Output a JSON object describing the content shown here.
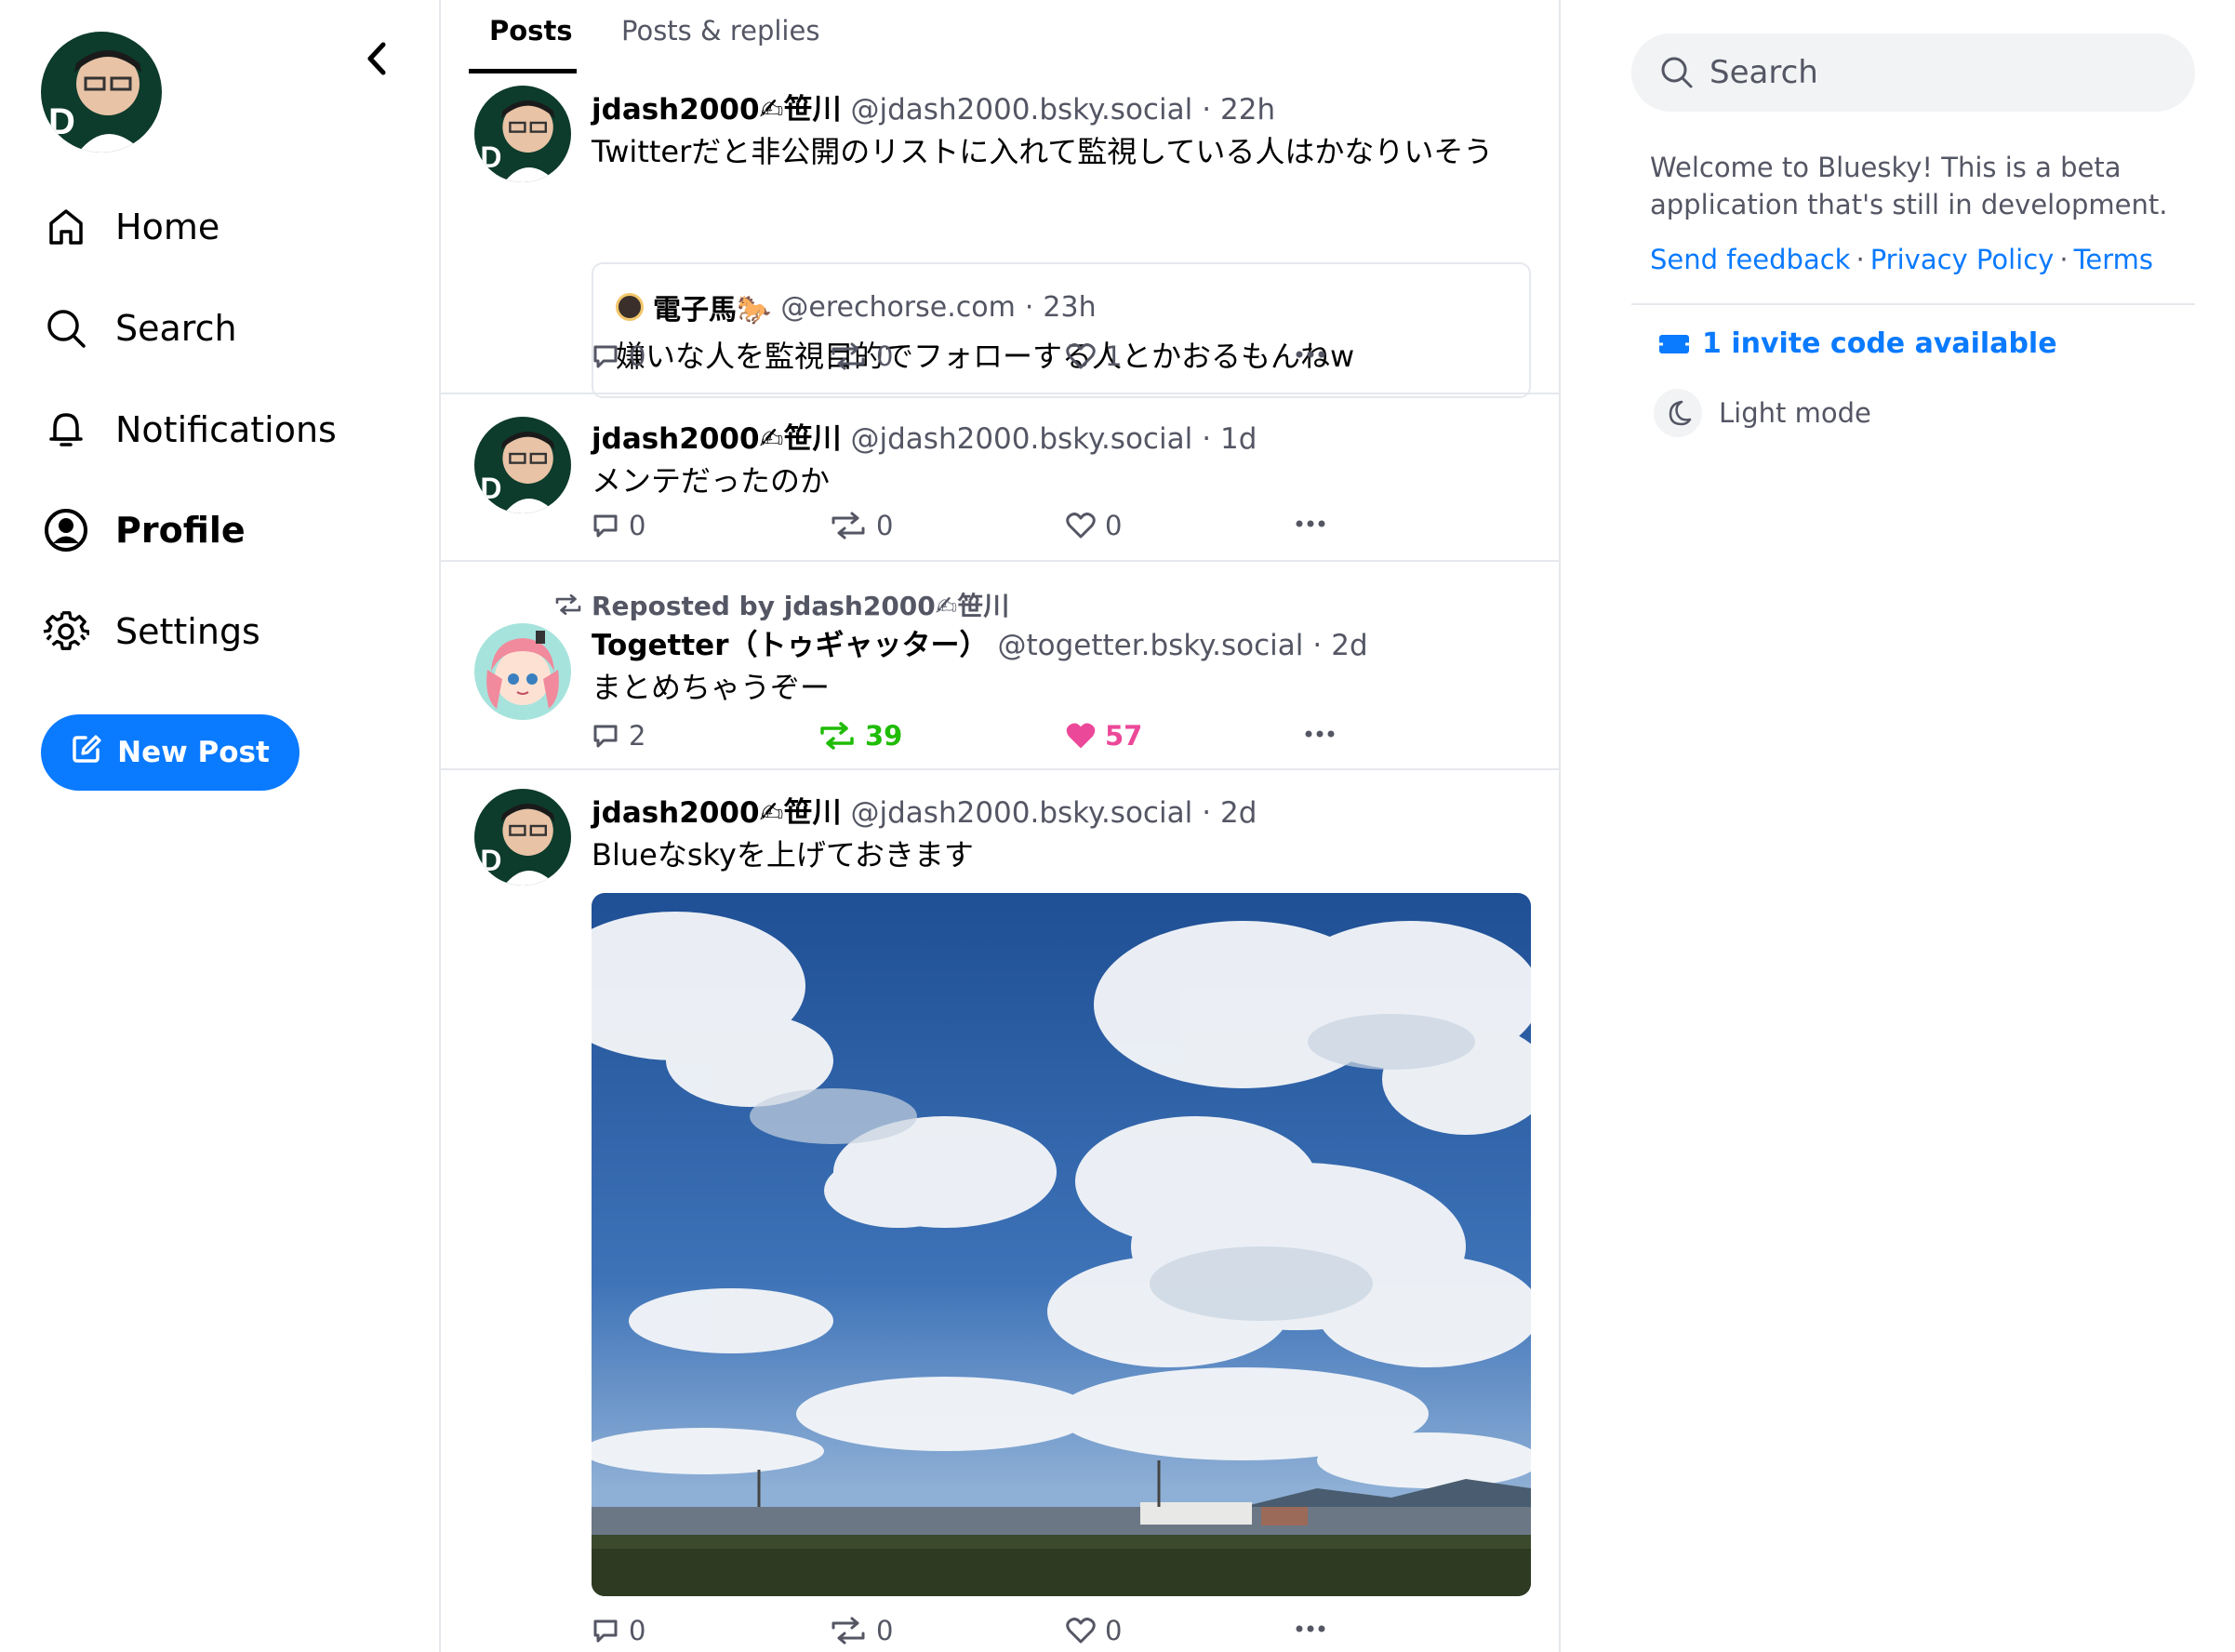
{
  "nav": {
    "items": [
      {
        "label": "Home",
        "icon": "home-icon"
      },
      {
        "label": "Search",
        "icon": "search-icon"
      },
      {
        "label": "Notifications",
        "icon": "bell-icon"
      },
      {
        "label": "Profile",
        "icon": "profile-icon"
      },
      {
        "label": "Settings",
        "icon": "gear-icon"
      }
    ],
    "active": "Profile",
    "new_post_label": "New Post"
  },
  "tabs": [
    {
      "label": "Posts",
      "active": true
    },
    {
      "label": "Posts & replies",
      "active": false
    }
  ],
  "posts": [
    {
      "author_name": "jdash2000✍笹川",
      "handle": "@jdash2000.bsky.social",
      "time": "22h",
      "text": "Twitterだと非公開のリストに入れて監視している人はかなりいそう",
      "quote": {
        "author_name": "電子馬🐎",
        "handle": "@erechorse.com",
        "time": "23h",
        "text": "嫌いな人を監視目的でフォローする人とかおるもんねw"
      },
      "replies": "0",
      "reposts": "0",
      "likes": "1"
    },
    {
      "author_name": "jdash2000✍笹川",
      "handle": "@jdash2000.bsky.social",
      "time": "1d",
      "text": "メンテだったのか",
      "replies": "0",
      "reposts": "0",
      "likes": "0"
    },
    {
      "reposted_by": "Reposted by jdash2000✍笹川",
      "author_name": "Togetter（トゥギャッター）",
      "handle": "@togetter.bsky.social",
      "time": "2d",
      "text": "まとめちゃうぞー",
      "replies": "2",
      "reposts": "39",
      "likes": "57"
    },
    {
      "author_name": "jdash2000✍笹川",
      "handle": "@jdash2000.bsky.social",
      "time": "2d",
      "text": "Blueなskyを上げておきます",
      "replies": "0",
      "reposts": "0",
      "likes": "0"
    }
  ],
  "right": {
    "search_placeholder": "Search",
    "welcome": "Welcome to Bluesky! This is a beta application that's still in development.",
    "links": [
      "Send feedback",
      "Privacy Policy",
      "Terms"
    ],
    "invite": "1 invite code available",
    "light_mode": "Light mode"
  },
  "colors": {
    "accent": "#0a7aff",
    "repost_active": "#20bc07",
    "like_active": "#ec4899",
    "muted": "#545664",
    "border": "#e5e8ed"
  }
}
